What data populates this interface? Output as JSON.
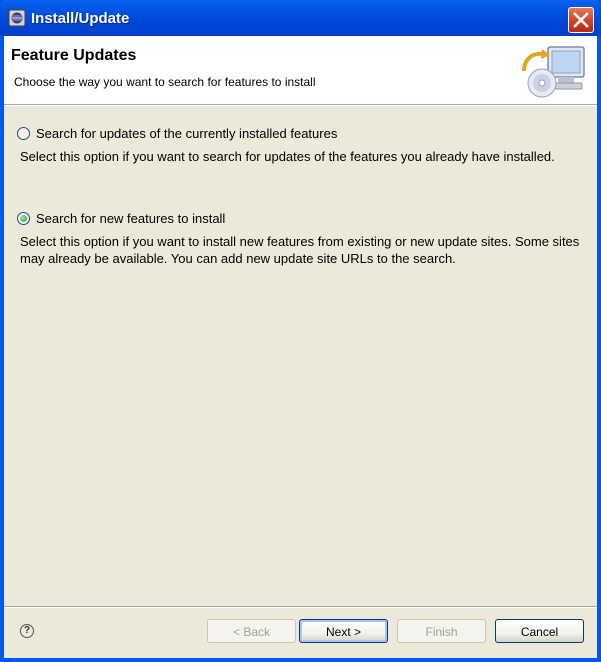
{
  "window": {
    "title": "Install/Update"
  },
  "banner": {
    "title": "Feature Updates",
    "description": "Choose the way you want to search for features to install"
  },
  "options": [
    {
      "label": "Search for updates of the currently installed features",
      "selected": false,
      "description": "Select this option if you want to search for updates of the features you already have installed."
    },
    {
      "label": "Search for new features to install",
      "selected": true,
      "description": "Select this option if you want to install new features from existing or new update sites. Some sites may already be available. You can add new update site URLs to the search."
    }
  ],
  "buttons": {
    "back": "< Back",
    "next": "Next >",
    "finish": "Finish",
    "cancel": "Cancel"
  },
  "help": {
    "glyph": "?"
  }
}
